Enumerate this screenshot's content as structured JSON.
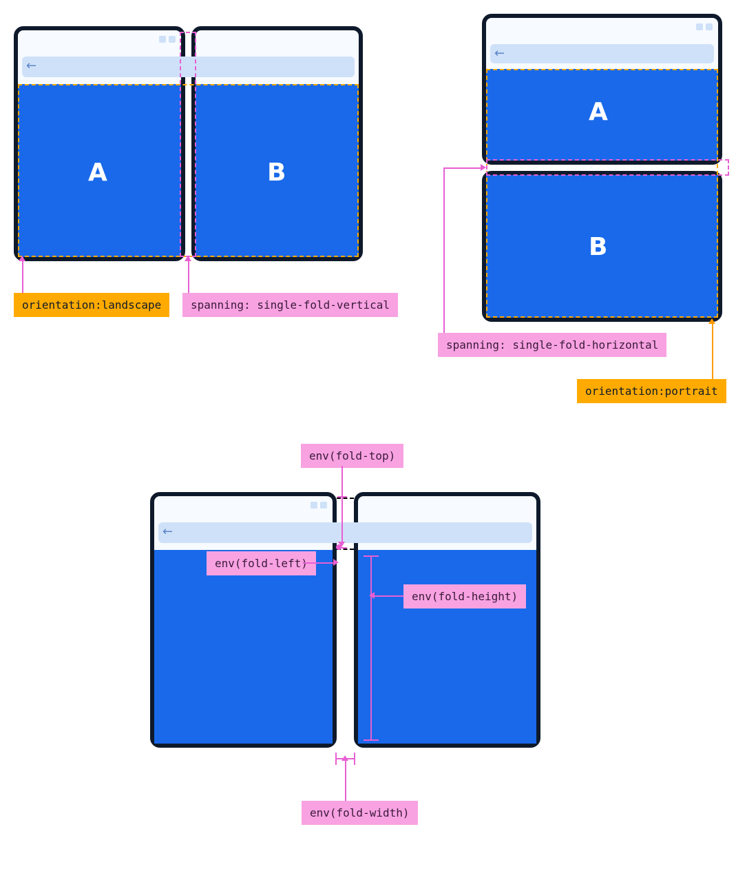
{
  "figure1": {
    "segments": {
      "left": "A",
      "right": "B"
    },
    "colors": {
      "viewport_outline": "#ffaa00",
      "fold_outline": "#e85fd3"
    },
    "labels": {
      "orientation": "orientation:landscape",
      "spanning": "spanning: single-fold-vertical"
    }
  },
  "figure2": {
    "segments": {
      "top": "A",
      "bottom": "B"
    },
    "colors": {
      "viewport_outline": "#ffaa00",
      "fold_outline": "#e85fd3"
    },
    "labels": {
      "spanning": "spanning: single-fold-horizontal",
      "orientation": "orientation:portrait"
    }
  },
  "figure3": {
    "labels": {
      "fold_top": "env(fold-top)",
      "fold_left": "env(fold-left)",
      "fold_height": "env(fold-height)",
      "fold_width": "env(fold-width)"
    }
  }
}
